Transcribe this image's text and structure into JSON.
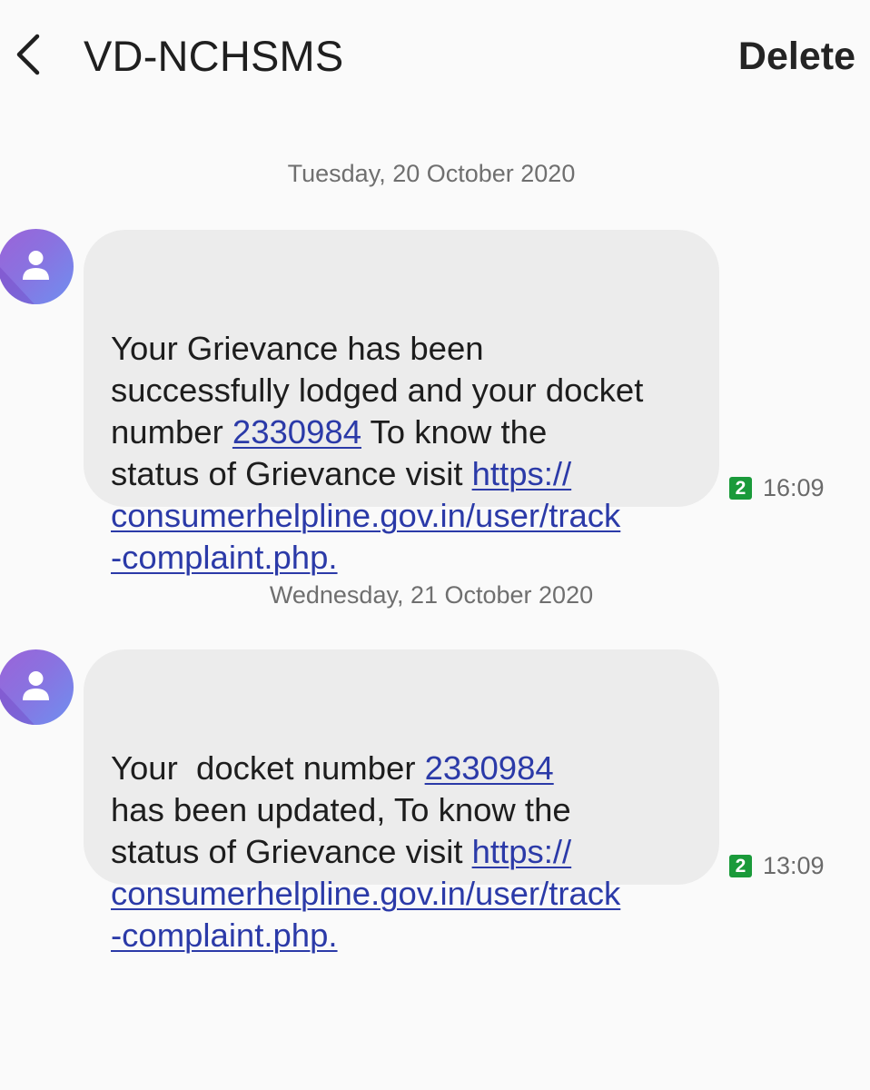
{
  "header": {
    "back_icon": "chevron-left-icon",
    "title": "VD-NCHSMS",
    "delete_label": "Delete"
  },
  "messages": [
    {
      "date": "Tuesday, 20 October 2020",
      "lines": [
        [
          "Your Grievance has been"
        ],
        [
          "successfully lodged and your docket"
        ],
        [
          "number ",
          {
            "link": "2330984"
          },
          " To know the"
        ],
        [
          "status of Grievance visit ",
          {
            "link": "https://"
          }
        ],
        [
          {
            "link": "consumerhelpline.gov.in/user/track"
          }
        ],
        [
          {
            "link": "-complaint.php."
          }
        ]
      ],
      "sim": "2",
      "time": "16:09"
    },
    {
      "date": "Wednesday, 21 October 2020",
      "lines": [
        [
          "Your  docket number ",
          {
            "link": "2330984"
          }
        ],
        [
          "has been updated, To know the"
        ],
        [
          "status of Grievance visit ",
          {
            "link": "https://"
          }
        ],
        [
          {
            "link": "consumerhelpline.gov.in/user/track"
          }
        ],
        [
          {
            "link": "-complaint.php."
          }
        ]
      ],
      "sim": "2",
      "time": "13:09"
    }
  ],
  "colors": {
    "link": "#2b3aa8",
    "bubble": "#ececec",
    "sim_badge": "#1a9a3a",
    "avatar_start": "#9b63d8",
    "avatar_end": "#6f8ff0"
  }
}
